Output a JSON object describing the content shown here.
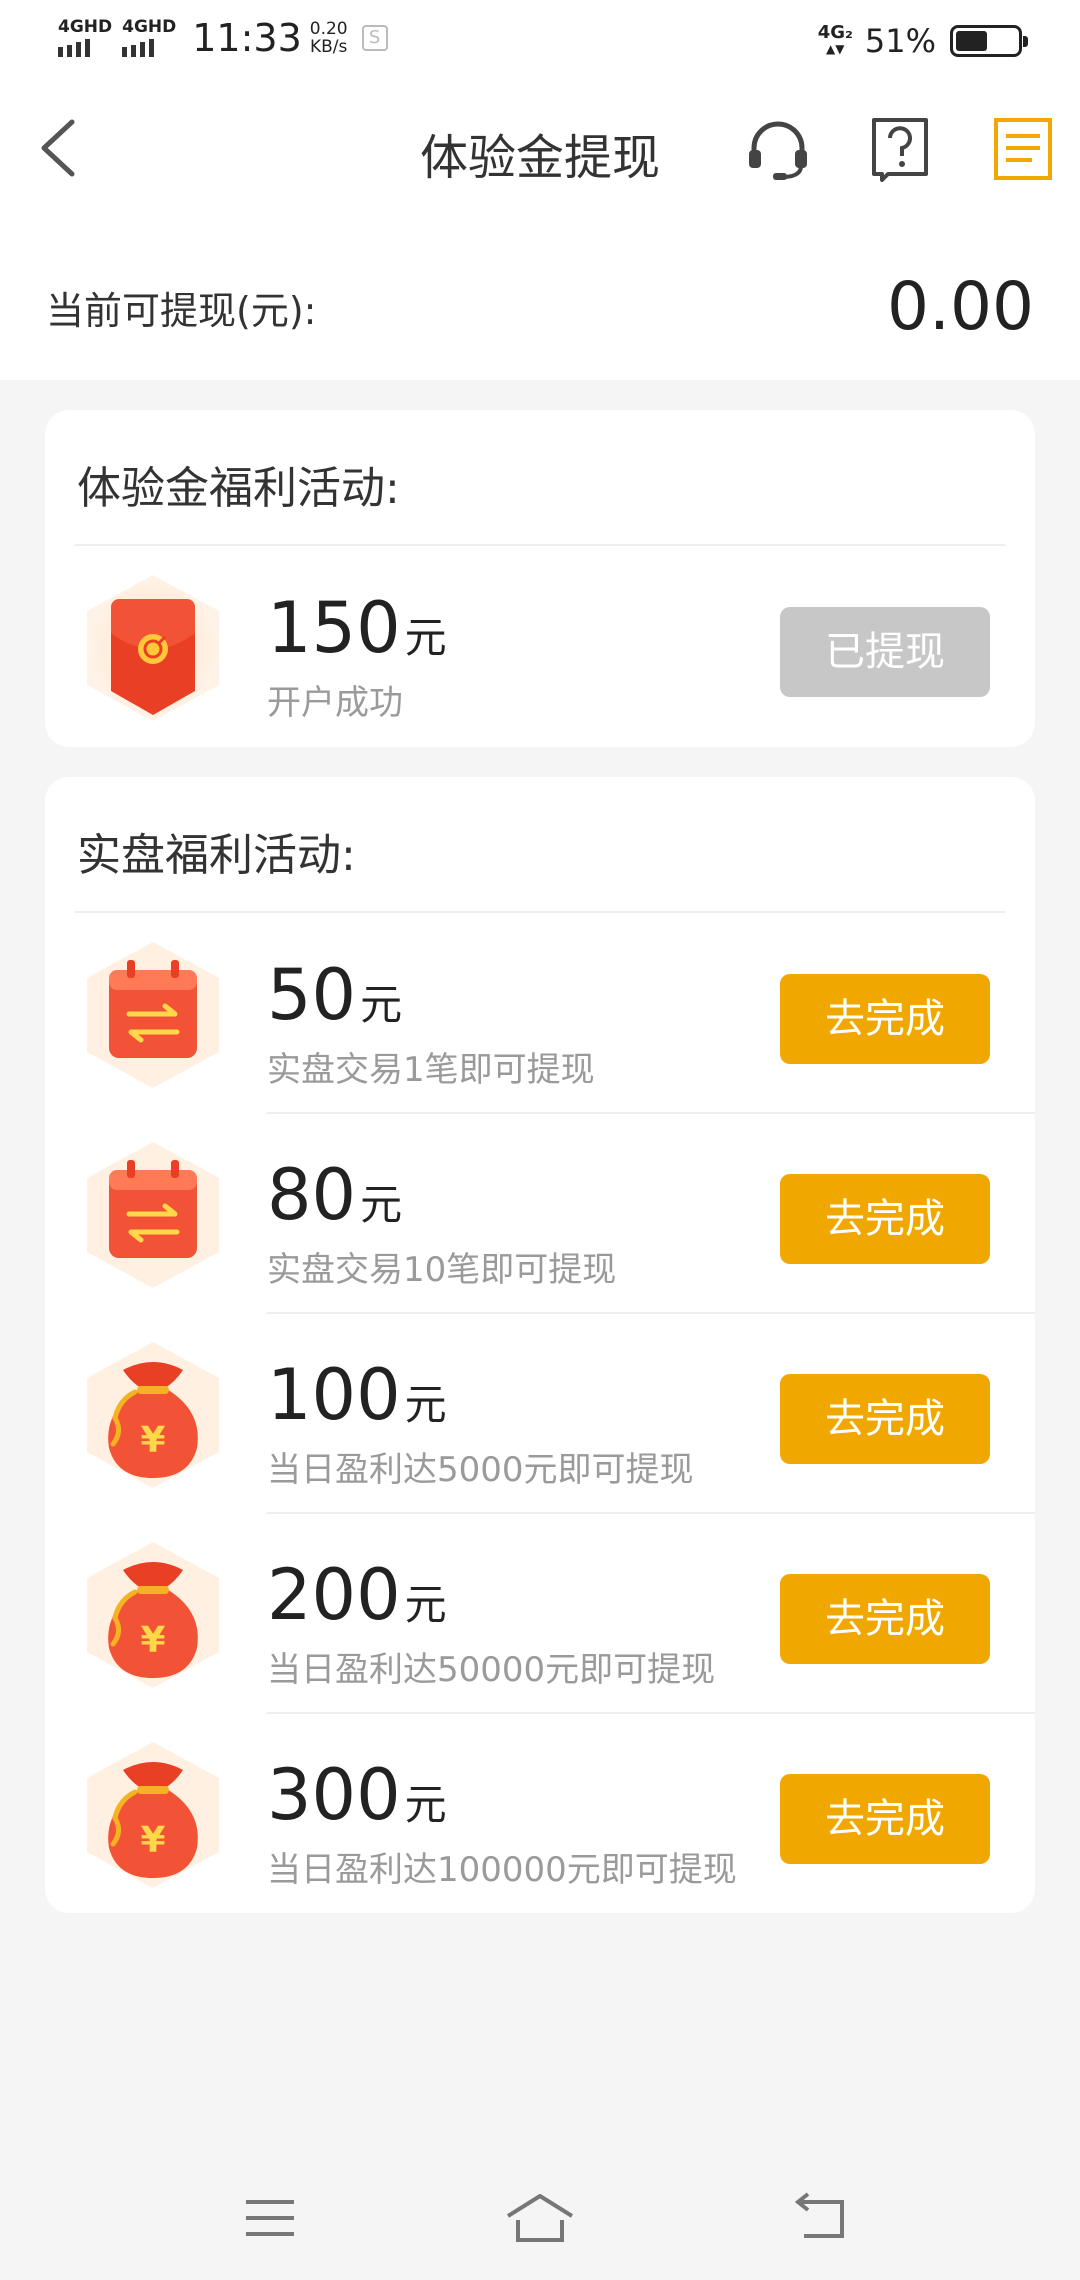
{
  "status_bar": {
    "sim1_label": "4GHD",
    "sim2_label": "4GHD",
    "time": "11:33",
    "speed_value": "0.20",
    "speed_unit": "KB/s",
    "network_label": "4G₂",
    "battery_text": "51%",
    "battery_level": 0.51
  },
  "header": {
    "title": "体验金提现"
  },
  "balance": {
    "label": "当前可提现(元):",
    "value": "0.00"
  },
  "experience_section": {
    "title": "体验金福利活动:",
    "items": [
      {
        "amount": "150",
        "unit": "元",
        "desc": "开户成功",
        "button": "已提现",
        "icon": "red-envelope-icon"
      }
    ]
  },
  "real_section": {
    "title": "实盘福利活动:",
    "items": [
      {
        "amount": "50",
        "unit": "元",
        "desc": "实盘交易1笔即可提现",
        "button": "去完成",
        "icon": "exchange-card-icon"
      },
      {
        "amount": "80",
        "unit": "元",
        "desc": "实盘交易10笔即可提现",
        "button": "去完成",
        "icon": "exchange-card-icon"
      },
      {
        "amount": "100",
        "unit": "元",
        "desc": "当日盈利达5000元即可提现",
        "button": "去完成",
        "icon": "money-bag-icon"
      },
      {
        "amount": "200",
        "unit": "元",
        "desc": "当日盈利达50000元即可提现",
        "button": "去完成",
        "icon": "money-bag-icon"
      },
      {
        "amount": "300",
        "unit": "元",
        "desc": "当日盈利达100000元即可提现",
        "button": "去完成",
        "icon": "money-bag-icon"
      }
    ]
  },
  "colors": {
    "accent": "#f0a800",
    "disabled": "#c7c7c7",
    "icon_red": "#f25236"
  }
}
